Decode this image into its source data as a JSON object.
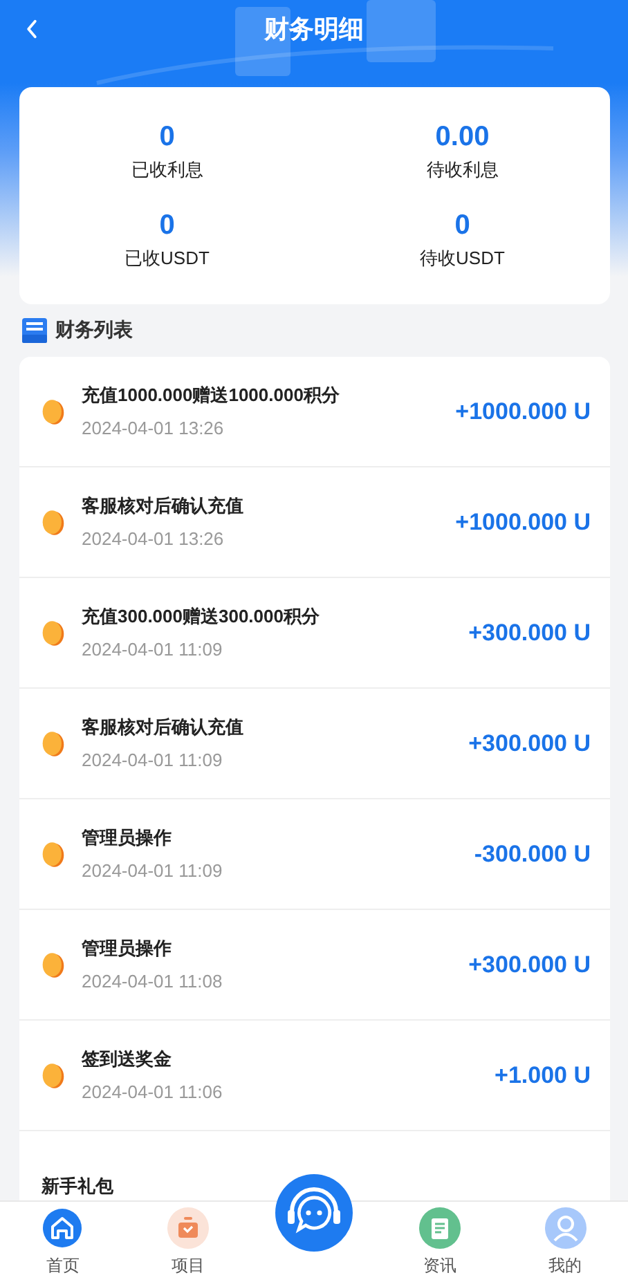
{
  "header": {
    "title": "财务明细"
  },
  "summary": [
    {
      "value": "0",
      "label": "已收利息"
    },
    {
      "value": "0.00",
      "label": "待收利息"
    },
    {
      "value": "0",
      "label": "已收USDT"
    },
    {
      "value": "0",
      "label": "待收USDT"
    }
  ],
  "section": {
    "title": "财务列表"
  },
  "records": [
    {
      "title": "充值1000.000赠送1000.000积分",
      "time": "2024-04-01 13:26",
      "amount": "+1000.000 U"
    },
    {
      "title": "客服核对后确认充值",
      "time": "2024-04-01 13:26",
      "amount": "+1000.000 U"
    },
    {
      "title": "充值300.000赠送300.000积分",
      "time": "2024-04-01 11:09",
      "amount": "+300.000 U"
    },
    {
      "title": "客服核对后确认充值",
      "time": "2024-04-01 11:09",
      "amount": "+300.000 U"
    },
    {
      "title": "管理员操作",
      "time": "2024-04-01 11:09",
      "amount": "-300.000 U"
    },
    {
      "title": "管理员操作",
      "time": "2024-04-01 11:08",
      "amount": "+300.000 U"
    },
    {
      "title": "签到送奖金",
      "time": "2024-04-01 11:06",
      "amount": "+1.000 U"
    },
    {
      "title": "新手礼包"
    }
  ],
  "tab_bar": [
    {
      "kind": "home",
      "label": "首页"
    },
    {
      "kind": "project",
      "label": "项目"
    },
    {
      "kind": "service"
    },
    {
      "kind": "news",
      "label": "资讯"
    },
    {
      "kind": "profile",
      "label": "我的"
    }
  ]
}
